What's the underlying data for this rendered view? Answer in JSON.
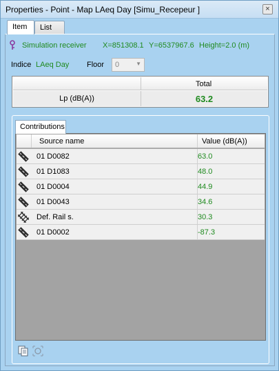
{
  "window": {
    "title": "Properties - Point - Map LAeq Day [Simu_Recepeur ]",
    "close_label": "×"
  },
  "tabs": [
    {
      "label": "Item",
      "active": true
    },
    {
      "label": "List",
      "active": false
    }
  ],
  "receiver": {
    "icon": "receiver-pin-icon",
    "label": "Simulation receiver",
    "x": "X=851308.1",
    "y": "Y=6537967.6",
    "height": "Height=2.0 (m)"
  },
  "indice": {
    "label": "Indice",
    "value": "LAeq Day"
  },
  "floor": {
    "label": "Floor",
    "value": "0"
  },
  "total_table": {
    "header": "Total",
    "row_label": "Lp (dB(A))",
    "row_value": "63.2"
  },
  "contributions": {
    "tab_label": "Contributions",
    "columns": [
      "Source name",
      "Value (dB(A))"
    ],
    "rows": [
      {
        "icon": "road-source-icon",
        "name": "01 D0082",
        "value": "63.0"
      },
      {
        "icon": "road-source-icon",
        "name": "01 D1083",
        "value": "48.0"
      },
      {
        "icon": "road-source-icon",
        "name": "01 D0004",
        "value": "44.9"
      },
      {
        "icon": "road-source-icon",
        "name": "01 D0043",
        "value": "34.6"
      },
      {
        "icon": "rail-source-icon",
        "name": "Def. Rail s.",
        "value": "30.3"
      },
      {
        "icon": "road-source-icon",
        "name": "01 D0002",
        "value": "-87.3"
      }
    ]
  },
  "footer": {
    "copy_icon": "copy-icon",
    "zoom_icon": "zoom-to-icon"
  },
  "colors": {
    "panel_background": "#a9d2f0",
    "value_green": "#1f8a1f",
    "grid_empty": "#a3a3a3"
  }
}
